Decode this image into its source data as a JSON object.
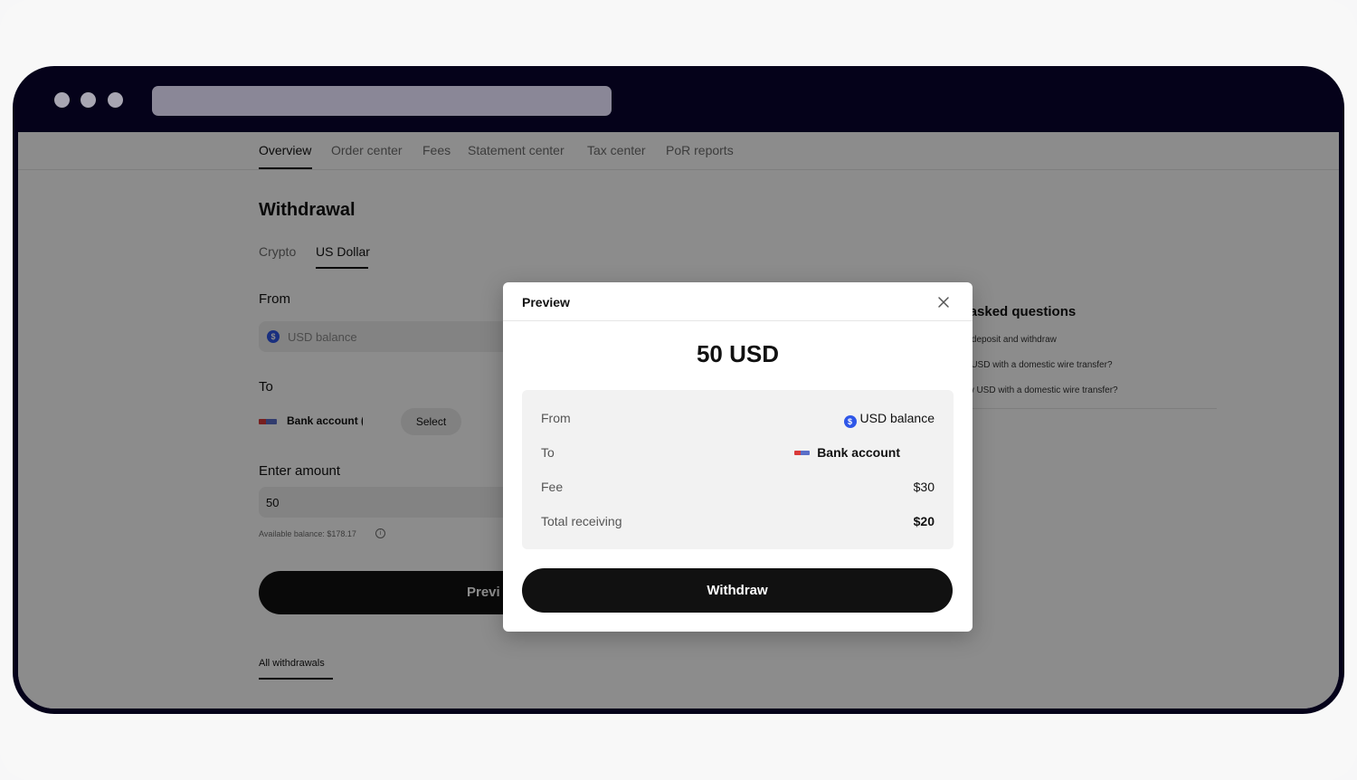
{
  "nav": {
    "tabs": [
      "Overview",
      "Order center",
      "Fees",
      "Statement center",
      "Tax center",
      "PoR reports"
    ]
  },
  "withdrawal": {
    "title": "Withdrawal",
    "sub_tabs": [
      "Crypto",
      "US Dollar"
    ],
    "from_label": "From",
    "from_placeholder": "USD balance",
    "to_label": "To",
    "to_bank_name": "Bank account (",
    "select_label": "Select",
    "amount_label": "Enter amount",
    "amount_value": "50",
    "available_balance": "Available balance: $178.17",
    "preview_label": "Previ",
    "all_withdrawals": "All withdrawals"
  },
  "faq": {
    "title": "ly asked questions",
    "items": [
      "ash deposit and withdraw",
      "osit USD with a domestic wire transfer?",
      "draw USD with a domestic wire transfer?"
    ]
  },
  "modal": {
    "title": "Preview",
    "amount": "50 USD",
    "rows": {
      "from_label": "From",
      "from_value": "USD balance",
      "to_label": "To",
      "to_value": "Bank account",
      "fee_label": "Fee",
      "fee_value": "$30",
      "total_label": "Total receiving",
      "total_value": "$20"
    },
    "withdraw_label": "Withdraw"
  },
  "icons": {
    "coin_symbol": "$",
    "info_symbol": "i",
    "coin_color": "#2f57e8"
  }
}
